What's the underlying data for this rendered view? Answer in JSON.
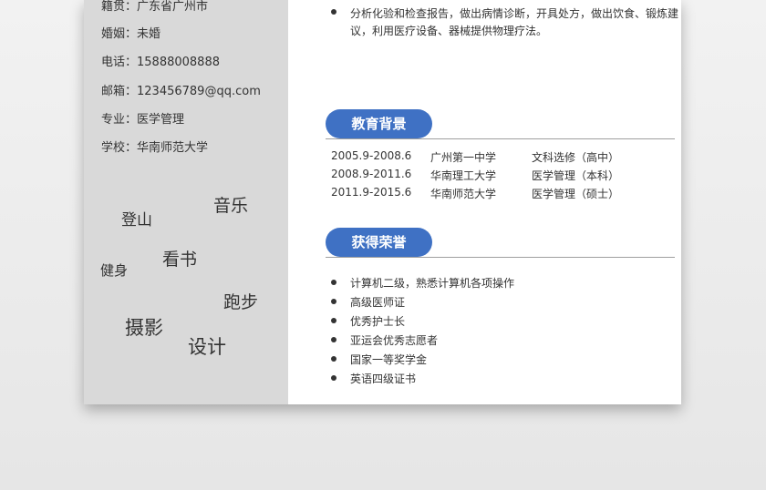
{
  "sidebar": {
    "info": [
      {
        "label": "籍贯：",
        "value": "广东省广州市"
      },
      {
        "label": "婚姻：",
        "value": "未婚"
      },
      {
        "label": "电话：",
        "value": "15888008888"
      },
      {
        "label": "邮箱：",
        "value": "123456789@qq.com"
      },
      {
        "label": "专业：",
        "value": "医学管理"
      },
      {
        "label": "学校：",
        "value": "华南师范大学"
      }
    ],
    "hobbies": [
      "音乐",
      "登山",
      "看书",
      "健身",
      "跑步",
      "摄影",
      "设计"
    ]
  },
  "experience": {
    "bullet_line1": "分析化验和检查报告，做出病情诊断，开具处方，做出饮食、锻炼建",
    "bullet_line2": "议，利用医疗设备、器械提供物理疗法。"
  },
  "education": {
    "title": "教育背景",
    "rows": [
      {
        "period": "2005.9-2008.6",
        "school": "广州第一中学",
        "major": "文科选修（高中）"
      },
      {
        "period": "2008.9-2011.6",
        "school": "华南理工大学",
        "major": "医学管理（本科）"
      },
      {
        "period": "2011.9-2015.6",
        "school": "华南师范大学",
        "major": "医学管理（硕士）"
      }
    ]
  },
  "honors": {
    "title": "获得荣誉",
    "items": [
      "计算机二级，熟悉计算机各项操作",
      "高级医师证",
      "优秀护士长",
      "亚运会优秀志愿者",
      "国家一等奖学金",
      "英语四级证书"
    ]
  },
  "colors": {
    "accent": "#3f71c4",
    "sidebar": "#d9d9d9",
    "text": "#333333"
  }
}
